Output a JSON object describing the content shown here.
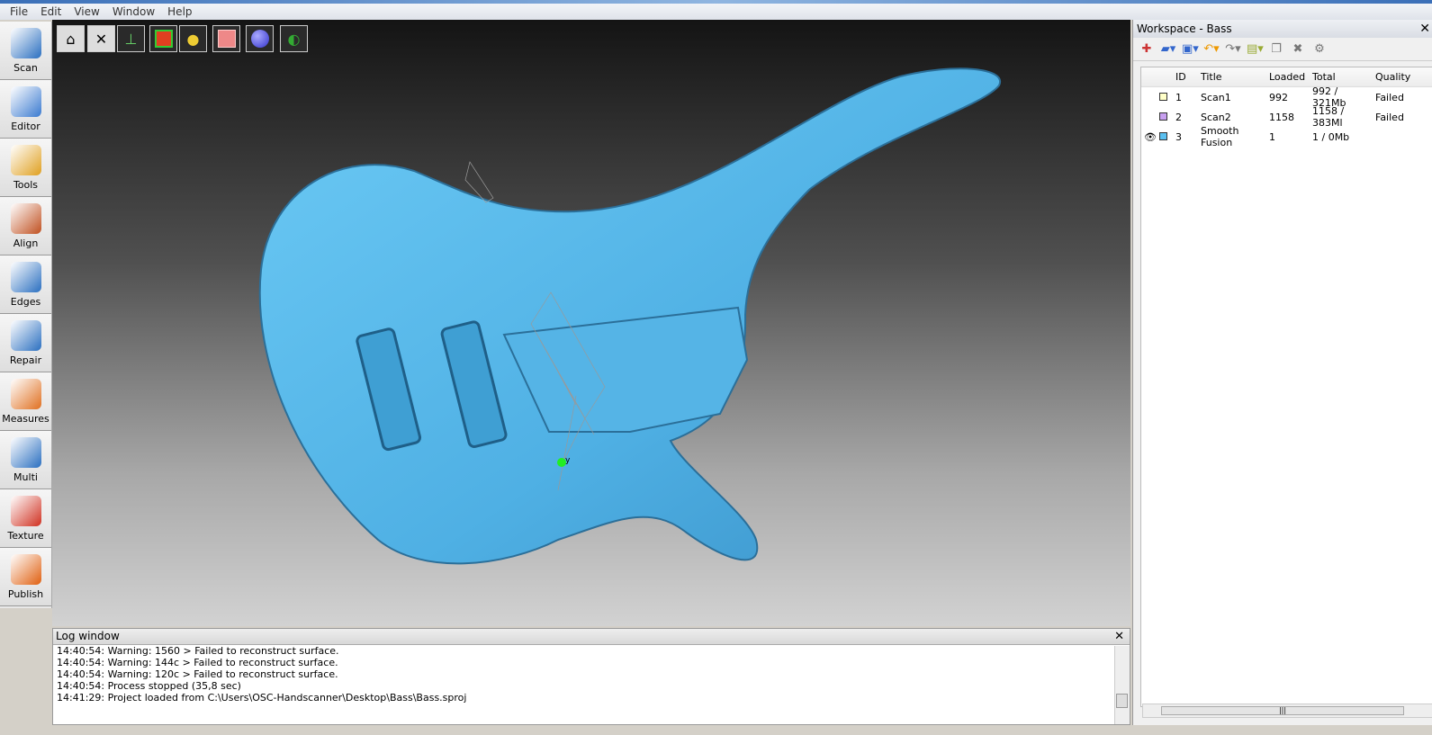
{
  "menu": [
    "File",
    "Edit",
    "View",
    "Window",
    "Help"
  ],
  "left_tools": [
    {
      "label": "Scan",
      "color": "#2a6fc0"
    },
    {
      "label": "Editor",
      "color": "#3a7ad0"
    },
    {
      "label": "Tools",
      "color": "#e0a020"
    },
    {
      "label": "Align",
      "color": "#c05020"
    },
    {
      "label": "Edges",
      "color": "#2a6fc0"
    },
    {
      "label": "Repair",
      "color": "#2a6fc0"
    },
    {
      "label": "Measures",
      "color": "#e07020"
    },
    {
      "label": "Multi",
      "color": "#2a6fc0"
    },
    {
      "label": "Texture",
      "color": "#d03020"
    },
    {
      "label": "Publish",
      "color": "#e06010"
    }
  ],
  "view_buttons": [
    "home-view",
    "fit-view",
    "axes",
    "bounding-box",
    "light",
    "material",
    "sphere",
    "shading"
  ],
  "log": {
    "title": "Log window",
    "lines": [
      "14:40:54: Warning: 1560 > Failed to reconstruct surface.",
      "14:40:54: Warning: 144c > Failed to reconstruct surface.",
      "14:40:54: Warning: 120c > Failed to reconstruct surface.",
      "14:40:54: Process stopped (35,8 sec)",
      "14:41:29: Project loaded from C:\\Users\\OSC-Handscanner\\Desktop\\Bass\\Bass.sproj"
    ]
  },
  "workspace": {
    "title": "Workspace - Bass",
    "columns": [
      "ID",
      "Title",
      "Loaded",
      "Total",
      "Quality"
    ],
    "rows": [
      {
        "id": "1",
        "title": "Scan1",
        "loaded": "992",
        "total": "992 / 321Mb",
        "quality": "Failed",
        "color": "#ffffc8",
        "visible": false
      },
      {
        "id": "2",
        "title": "Scan2",
        "loaded": "1158",
        "total": "1158 / 383Ml",
        "quality": "Failed",
        "color": "#c8a0f0",
        "visible": false
      },
      {
        "id": "3",
        "title": "Smooth Fusion",
        "loaded": "1",
        "total": "1 / 0Mb",
        "quality": "",
        "color": "#5bc0f0",
        "visible": true
      }
    ]
  },
  "model_color": "#5bb8e8",
  "axis_label": "y"
}
